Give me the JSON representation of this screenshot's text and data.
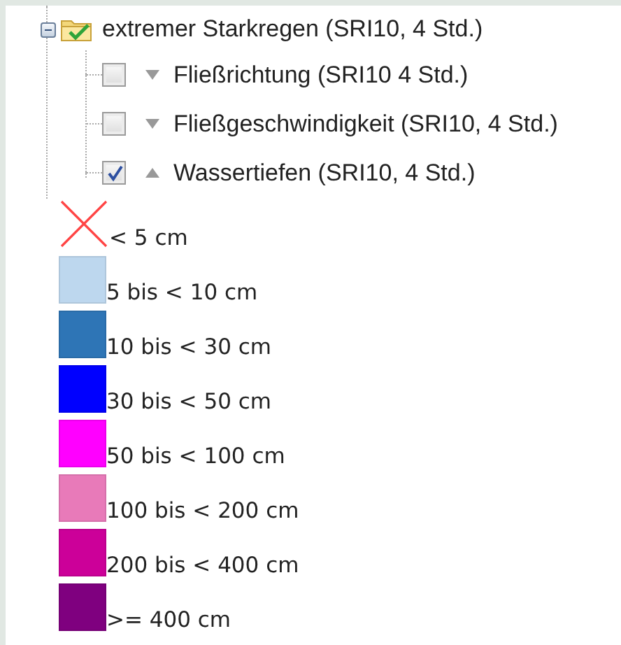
{
  "group": {
    "label": "extremer Starkregen (SRI10, 4 Std.)",
    "expanded": true,
    "checked": true
  },
  "layers": [
    {
      "label": "Fließrichtung (SRI10 4 Std.)",
      "checked": false,
      "expanded": false
    },
    {
      "label": "Fließgeschwindigkeit (SRI10, 4 Std.)",
      "checked": false,
      "expanded": false
    },
    {
      "label": "Wassertiefen (SRI10, 4 Std.)",
      "checked": true,
      "expanded": true
    }
  ],
  "legend": [
    {
      "kind": "cross",
      "label": "< 5 cm",
      "color": "#ff4444"
    },
    {
      "kind": "swatch",
      "label": "5 bis < 10 cm",
      "color": "#bdd7ee"
    },
    {
      "kind": "swatch",
      "label": "10 bis < 30 cm",
      "color": "#2e75b6"
    },
    {
      "kind": "swatch",
      "label": "30 bis < 50 cm",
      "color": "#0000ff"
    },
    {
      "kind": "swatch",
      "label": "50 bis < 100 cm",
      "color": "#ff00ff"
    },
    {
      "kind": "swatch",
      "label": "100 bis < 200 cm",
      "color": "#e87ab9"
    },
    {
      "kind": "swatch",
      "label": "200 bis < 400 cm",
      "color": "#cc0099"
    },
    {
      "kind": "swatch",
      "label": ">= 400 cm",
      "color": "#7f007f"
    }
  ]
}
